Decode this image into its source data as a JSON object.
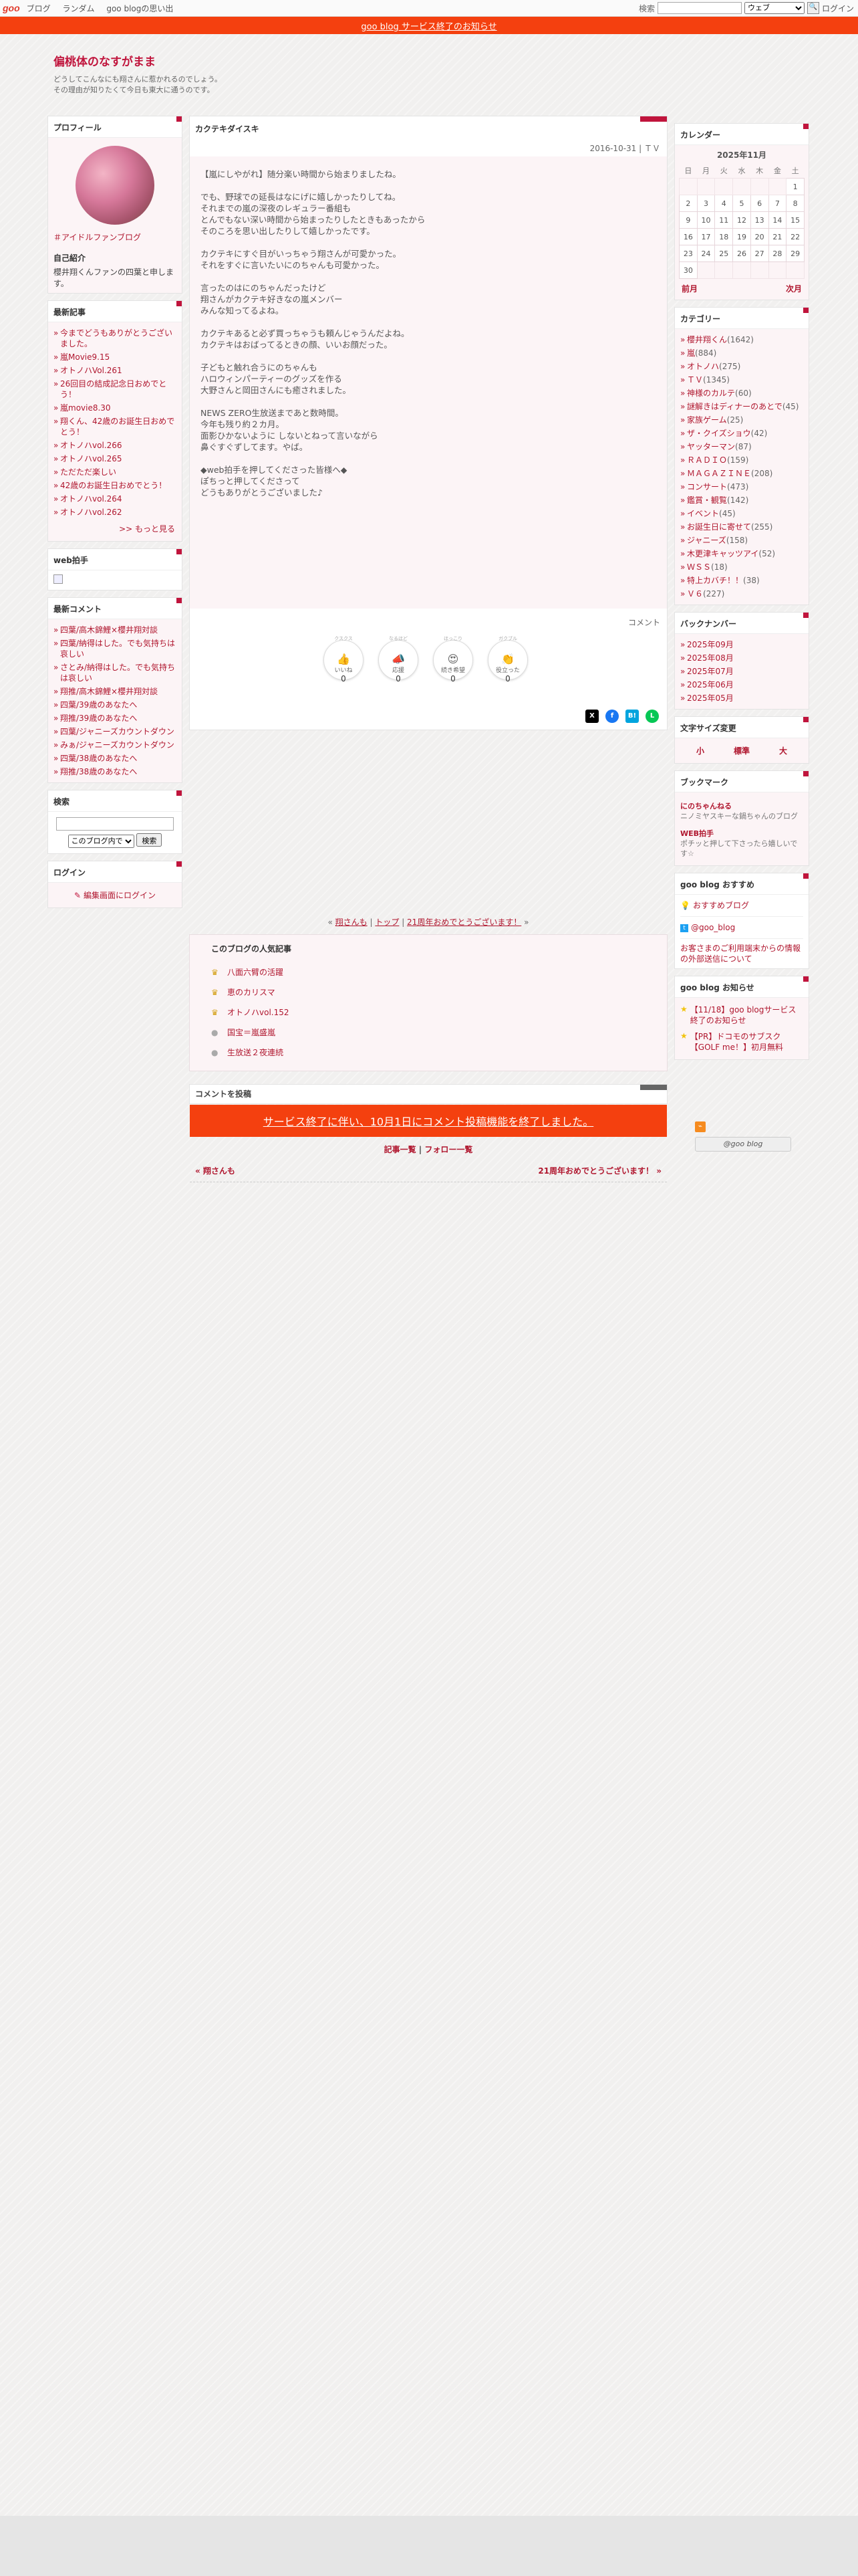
{
  "topbar": {
    "logo": "goo",
    "nav": [
      "ブログ",
      "ランダム",
      "goo blogの思い出"
    ],
    "search_label": "検索",
    "search_option": "ウェブ",
    "login": "ログイン"
  },
  "notice": "goo blog サービス終了のお知らせ",
  "blog": {
    "title": "偏桃体のなすがまま",
    "desc1": "どうしてこんなにも翔さんに惹かれるのでしょう。",
    "desc2": "その理由が知りたくて今日も東大に通うのです。"
  },
  "profile": {
    "title": "プロフィール",
    "link": "＃アイドルファンブログ",
    "intro_label": "自己紹介",
    "intro": "櫻井翔くんファンの四葉と申します。"
  },
  "recent": {
    "title": "最新記事",
    "items": [
      "今までどうもありがとうございました。",
      "嵐Movie9.15",
      "オトノハVol.261",
      "26回目の結成記念日おめでとう！",
      "嵐movie8.30",
      "翔くん、42歳のお誕生日おめでとう！",
      "オトノハvol.266",
      "オトノハvol.265",
      "ただただ楽しい",
      "42歳のお誕生日おめでとう！",
      "オトノハvol.264",
      "オトノハvol.262"
    ],
    "more": ">> もっと見る"
  },
  "webclap": {
    "title": "web拍手"
  },
  "comments": {
    "title": "最新コメント",
    "items": [
      "四葉/高木錦鯉×櫻井翔対談",
      "四葉/納得はした。でも気持ちは哀しい",
      "さとみ/納得はした。でも気持ちは哀しい",
      "翔推/高木錦鯉×櫻井翔対談",
      "四葉/39歳のあなたへ",
      "翔推/39歳のあなたへ",
      "四葉/ジャニーズカウントダウン",
      "みぁ/ジャニーズカウントダウン",
      "四葉/38歳のあなたへ",
      "翔推/38歳のあなたへ"
    ]
  },
  "search": {
    "title": "検索",
    "option": "このブログ内で",
    "button": "検索"
  },
  "login": {
    "title": "ログイン",
    "link": "編集画面にログイン"
  },
  "article": {
    "title": "カクテキダイスキ",
    "date": "2016-10-31",
    "category": "ＴＶ",
    "paragraphs": [
      "【嵐にしやがれ】随分楽い時間から始まりましたね。",
      "でも、野球での延長はなにげに嬉しかったりしてね。\nそれまでの嵐の深夜のレギュラー番組も\nとんでもない深い時間から始まったりしたときもあったから\nそのころを思い出したりして嬉しかったです。",
      "カクテキにすぐ目がいっちゃう翔さんが可愛かった。\nそれをすぐに言いたいにのちゃんも可愛かった。",
      "言ったのはにのちゃんだったけど\n翔さんがカクテキ好きなの嵐メンバー\nみんな知ってるよね。",
      "カクテキあると必ず買っちゃうも頼んじゃうんだよね。\nカクテキはおばってるときの顔、いいお顔だった。",
      "子どもと触れ合うにのちゃんも\nハロウィンパーティーのグッズを作る\n大野さんと岡田さんにも癒されました。",
      "NEWS ZERO生放送まであと数時間。\n今年も残り約２カ月。\n面影ひかないように しないとねって言いながら\n鼻ぐすぐずしてます。やば。",
      "◆web拍手を押してくださった皆様へ◆\nぽちっと押してくださって\nどうもありがとうございました♪"
    ],
    "comment_label": "コメント",
    "reactions": [
      {
        "top": "クスクス",
        "label": "いいね",
        "count": "0",
        "emoji": "👍"
      },
      {
        "top": "なるほど",
        "label": "応援",
        "count": "0",
        "emoji": "📣"
      },
      {
        "top": "ほっこり",
        "label": "続き希望",
        "count": "0",
        "emoji": "😍"
      },
      {
        "top": "ガクブル",
        "label": "役立った",
        "count": "0",
        "emoji": "👏"
      }
    ]
  },
  "postnav": {
    "prev": "翔さんも",
    "top": "トップ",
    "next": "21周年おめでとうございます！"
  },
  "popular": {
    "title": "このブログの人気記事",
    "items": [
      "八面六臂の活躍",
      "恵のカリスマ",
      "オトノハvol.152",
      "国宝＝嵐盛嵐",
      "生放送２夜連続"
    ]
  },
  "comment_post": "コメントを投稿",
  "closed": "サービス終了に伴い、10月1日にコメント投稿機能を終了しました。",
  "article_links": {
    "list": "記事一覧",
    "follow": "フォロー一覧"
  },
  "prevnext": {
    "prev": "« 翔さんも",
    "next": "21周年おめでとうございます！ »"
  },
  "calendar": {
    "title": "カレンダー",
    "month": "2025年11月",
    "weekdays": [
      "日",
      "月",
      "火",
      "水",
      "木",
      "金",
      "土"
    ],
    "days": [
      "",
      "",
      "",
      "",
      "",
      "",
      "1",
      "2",
      "3",
      "4",
      "5",
      "6",
      "7",
      "8",
      "9",
      "10",
      "11",
      "12",
      "13",
      "14",
      "15",
      "16",
      "17",
      "18",
      "19",
      "20",
      "21",
      "22",
      "23",
      "24",
      "25",
      "26",
      "27",
      "28",
      "29",
      "30",
      "",
      "",
      "",
      "",
      "",
      ""
    ],
    "prev": "前月",
    "next": "次月"
  },
  "categories": {
    "title": "カテゴリー",
    "items": [
      {
        "name": "櫻井翔くん",
        "count": "(1642)"
      },
      {
        "name": "嵐",
        "count": "(884)"
      },
      {
        "name": "オトノハ",
        "count": "(275)"
      },
      {
        "name": "ＴＶ",
        "count": "(1345)"
      },
      {
        "name": "神様のカルテ",
        "count": "(60)"
      },
      {
        "name": "謎解きはディナーのあとで",
        "count": "(45)"
      },
      {
        "name": "家族ゲーム",
        "count": "(25)"
      },
      {
        "name": "ザ・クイズショウ",
        "count": "(42)"
      },
      {
        "name": "ヤッターマン",
        "count": "(87)"
      },
      {
        "name": "ＲＡＤＩＯ",
        "count": "(159)"
      },
      {
        "name": "ＭＡＧＡＺＩＮＥ",
        "count": "(208)"
      },
      {
        "name": "コンサート",
        "count": "(473)"
      },
      {
        "name": "鑑賞・観覧",
        "count": "(142)"
      },
      {
        "name": "イベント",
        "count": "(45)"
      },
      {
        "name": "お誕生日に寄せて",
        "count": "(255)"
      },
      {
        "name": "ジャニーズ",
        "count": "(158)"
      },
      {
        "name": "木更津キャッツアイ",
        "count": "(52)"
      },
      {
        "name": "ＷＳＳ",
        "count": "(18)"
      },
      {
        "name": "特上カバチ！！",
        "count": "(38)"
      },
      {
        "name": "Ｖ６",
        "count": "(227)"
      }
    ]
  },
  "backnumber": {
    "title": "バックナンバー",
    "items": [
      "2025年09月",
      "2025年08月",
      "2025年07月",
      "2025年06月",
      "2025年05月"
    ]
  },
  "fontsize": {
    "title": "文字サイズ変更",
    "small": "小",
    "normal": "標準",
    "large": "大"
  },
  "bookmarks": {
    "title": "ブックマーク",
    "items": [
      {
        "name": "にのちゃんねる",
        "desc": "ニノミヤスキーな鍋ちゃんのブログ"
      },
      {
        "name": "WEB拍手",
        "desc": "ポチッと押して下さったら嬉しいです☆"
      }
    ]
  },
  "osusume": {
    "title": "goo blog おすすめ",
    "blog": "おすすめブログ",
    "twitter": "@goo_blog",
    "info": "お客さまのご利用端末からの情報の外部送信について"
  },
  "news": {
    "title": "goo blog お知らせ",
    "items": [
      "【11/18】goo blogサービス終了のお知らせ",
      "【PR】ドコモのサブスク【GOLF me！】初月無料"
    ]
  },
  "badge": "@goo blog"
}
